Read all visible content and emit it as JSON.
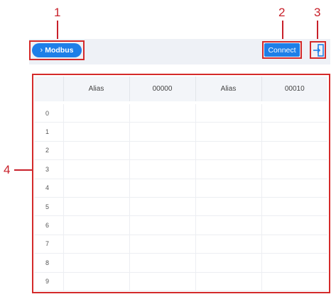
{
  "callouts": [
    "1",
    "2",
    "3",
    "4"
  ],
  "toolbar": {
    "modbus_label": "Modbus",
    "connect_label": "Connect",
    "export_icon": "export-icon"
  },
  "table": {
    "headers": [
      "",
      "Alias",
      "00000",
      "Alias",
      "00010"
    ],
    "rows": [
      "0",
      "1",
      "2",
      "3",
      "4",
      "5",
      "6",
      "7",
      "8",
      "9"
    ]
  },
  "colors": {
    "accent": "#1e7fe8",
    "callout": "#c8202a",
    "toolbar_bg": "#eef1f6",
    "header_bg": "#f3f5f9"
  }
}
